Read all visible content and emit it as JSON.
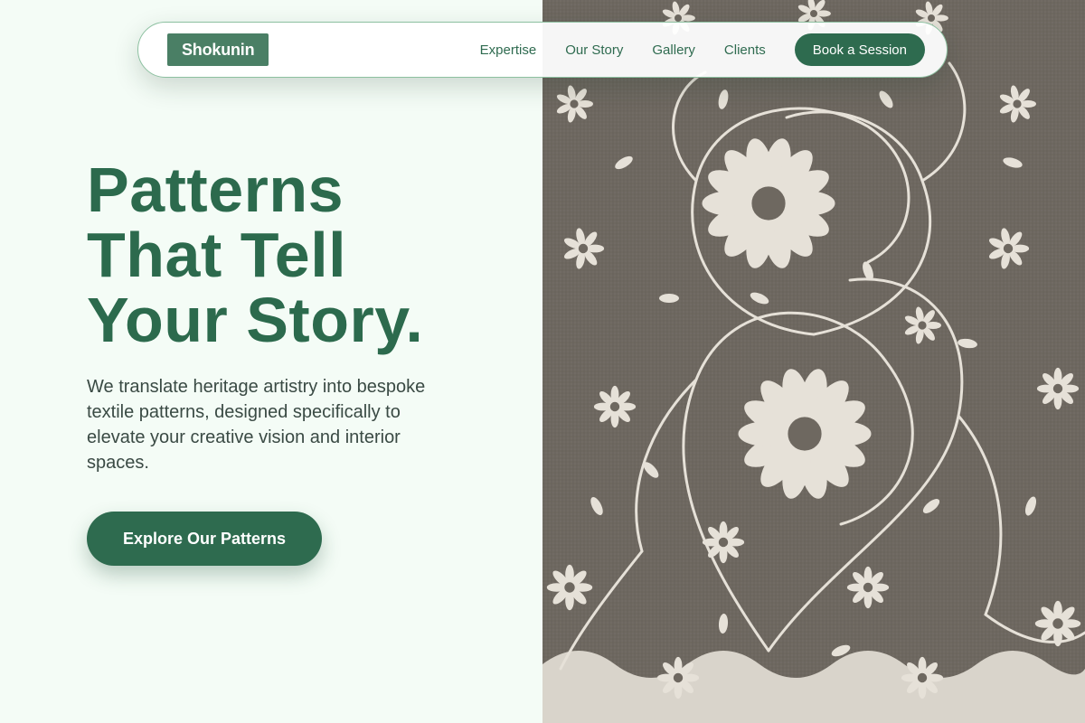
{
  "nav": {
    "logo": "Shokunin",
    "links": [
      "Expertise",
      "Our Story",
      "Gallery",
      "Clients"
    ],
    "cta": "Book a Session"
  },
  "hero": {
    "title_lines": [
      "Patterns",
      "That Tell",
      "Your Story."
    ],
    "description": "We translate heritage artistry into bespoke textile patterns, designed specifically to elevate your creative vision and interior spaces.",
    "cta": "Explore Our Patterns"
  },
  "image": {
    "subject": "embroidered-floral-textile",
    "colors": {
      "fabric": "#6d675f",
      "thread": "#e6e1d8"
    }
  },
  "theme": {
    "primary": "#2e6b4f",
    "title": "#2c6a4d",
    "background": "#f4fcf6",
    "logo_bg": "#4a7f65"
  }
}
